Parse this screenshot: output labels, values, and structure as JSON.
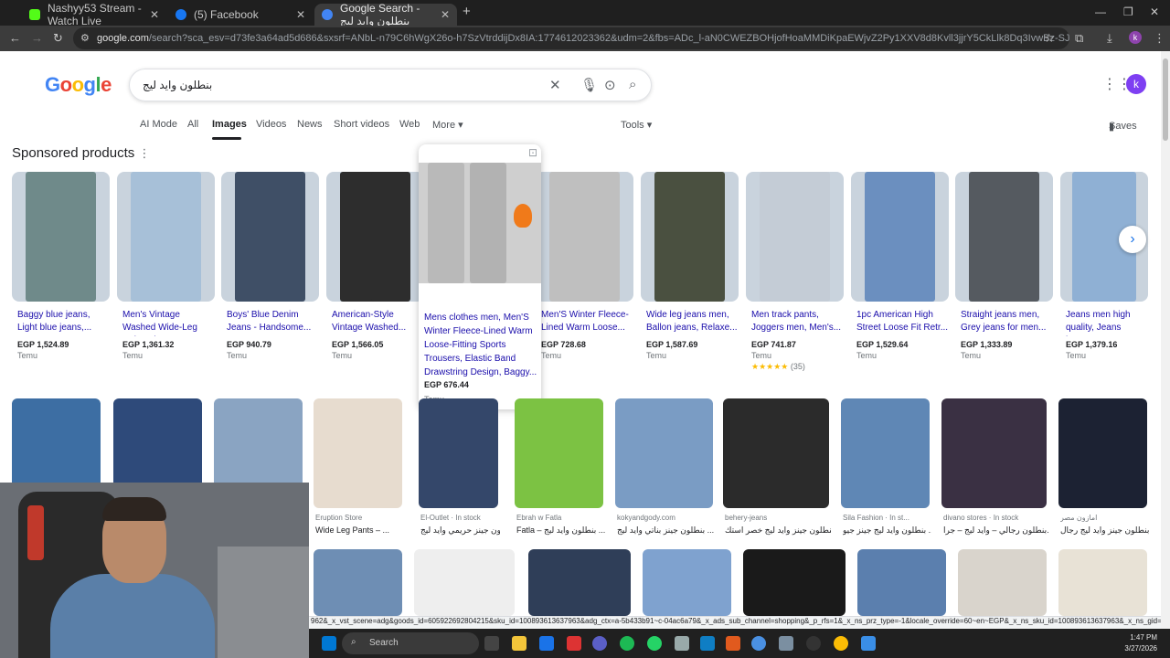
{
  "browser": {
    "tabs": [
      {
        "title": "Nashyy53 Stream - Watch Live",
        "color": "#53fc18"
      },
      {
        "title": "(5) Facebook",
        "color": "#1877f2"
      },
      {
        "title": "Google Search - بنطلون وايد ليج",
        "color": "#4285f4"
      }
    ],
    "new_tab_label": "+",
    "url_host": "google.com",
    "url_rest": "/search?sca_esv=d73fe3a64ad5d686&sxsrf=ANbL-n79C6hWgX26o-h7SzVtrddijDx8IA:1774612023362&udm=2&fbs=ADc_l-aN0CWEZBOHjofHoaMMDiKpaEWjvZ2Py1XXV8d8Kvll3jjrY5CkLlk8Dq3IvwBz-SJyfRX_inP-J3Cs9lQZu9JwbDjRLmo1..."
  },
  "google": {
    "logo": "Google",
    "query": "بنطلون وايد ليج",
    "avatar_letter": "k",
    "tabs": [
      "AI Mode",
      "All",
      "Images",
      "Videos",
      "News",
      "Short videos",
      "Web",
      "More ▾"
    ],
    "tools_label": "Tools ▾",
    "saves_label": "Saves"
  },
  "sponsored": {
    "heading": "Sponsored products",
    "products": [
      {
        "title": "Baggy blue jeans, Light blue jeans,...",
        "price": "EGP 1,524.89",
        "seller": "Temu",
        "color": "#6f8a8a"
      },
      {
        "title": "Men's Vintage Washed Wide-Leg Relaxed-F...",
        "price": "EGP 1,361.32",
        "seller": "Temu",
        "color": "#a7c0d8"
      },
      {
        "title": "Boys' Blue Denim Jeans - Handsome...",
        "price": "EGP 940.79",
        "seller": "Temu",
        "color": "#3f4f66"
      },
      {
        "title": "American-Style Vintage Washed...",
        "price": "EGP 1,566.05",
        "seller": "Temu",
        "color": "#2d2d2d"
      },
      {
        "title": "Men'S Winter Fleece-Lined Warm Loose...",
        "price": "EGP 728.68",
        "seller": "Temu",
        "color": "#bfbfbf"
      },
      {
        "title": "Wide leg jeans men, Ballon jeans, Relaxe...",
        "price": "EGP 1,587.69",
        "seller": "Temu",
        "color": "#4a5040"
      },
      {
        "title": "Men track pants, Joggers men, Men's...",
        "price": "EGP 741.87",
        "seller": "Temu",
        "rating": "★★★★★",
        "reviews": "(35)",
        "color": "#c4ccd6"
      },
      {
        "title": "1pc American High Street Loose Fit Retr...",
        "price": "EGP 1,529.64",
        "seller": "Temu",
        "color": "#6b8fbf"
      },
      {
        "title": "Straight jeans men, Grey jeans for men...",
        "price": "EGP 1,333.89",
        "seller": "Temu",
        "color": "#555a60"
      },
      {
        "title": "Jeans men high quality, Jeans baggy,...",
        "price": "EGP 1,379.16",
        "seller": "Temu",
        "color": "#8fb0d4"
      }
    ],
    "popup": {
      "title": "Mens clothes men, Men'S Winter Fleece-Lined Warm Loose-Fitting Sports Trousers, Elastic Band Drawstring Design, Baggy...",
      "price": "EGP 676.44",
      "seller": "Temu"
    }
  },
  "results": [
    {
      "source": "",
      "title": "",
      "color": "#3d6ea3"
    },
    {
      "source": "",
      "title": "",
      "color": "#2e4a7a"
    },
    {
      "source": "",
      "title": "",
      "color": "#8aa4c2"
    },
    {
      "source": "Eruption Store",
      "title": "Wide Leg Pants – ...",
      "color": "#e7dccf"
    },
    {
      "source": "El-Outlet · In stock",
      "title": "بنطلون جينز حريمي وايد ليج ...",
      "color": "#34476a"
    },
    {
      "source": "Ebrah w Fatla",
      "title": "Fatla – بنطلون وايد ليج ...",
      "color": "#7cc243"
    },
    {
      "source": "kokyandgody.com",
      "title": "بنطلون جينز بناتي وايد ليج ...",
      "color": "#7a9cc4"
    },
    {
      "source": "behery-jeans",
      "title": "بنطلون جينز وايد ليج خصر استك | ...",
      "color": "#2b2b2b"
    },
    {
      "source": "Sila Fashion · In st...",
      "title": "بنطلون وايد ليج جينز جيو ...",
      "color": "#5f87b5"
    },
    {
      "source": "divano stores · In stock",
      "title": "بنطلون رجالي – وايد ليج – جرا...",
      "color": "#3a3043"
    },
    {
      "source": "امازون مصر",
      "title": "بنطلون جينز وايد ليج رجال...",
      "color": "#1c2233"
    }
  ],
  "status_url": "962&_x_vst_scene=adg&goods_id=605922692804215&sku_id=100893613637963&adg_ctx=a-5b433b91~c-04ac6a79&_x_ads_sub_channel=shopping&_p_rfs=1&_x_ns_prz_type=-1&locale_override=60~en~EGP&_x_ns_sku_id=100893613637963&_x_ns_gid=...",
  "taskbar": {
    "search_label": "Search",
    "time": "1:47 PM",
    "date": "3/27/2026"
  }
}
